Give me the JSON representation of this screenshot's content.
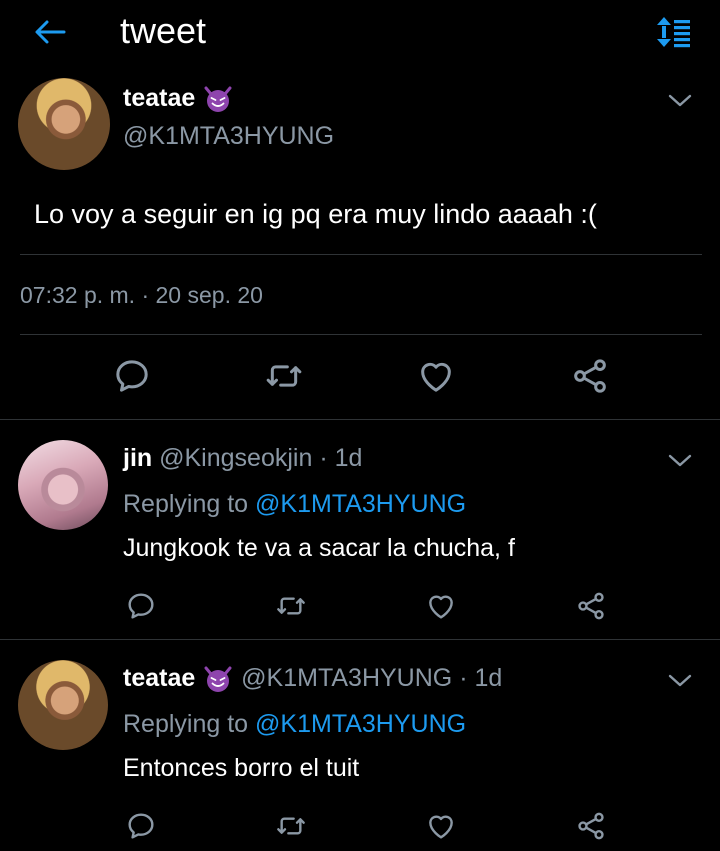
{
  "header": {
    "title": "tweet"
  },
  "icons": {
    "back": "arrow-left-icon",
    "sort": "sort-icon",
    "reply": "reply-icon",
    "retweet": "retweet-icon",
    "like": "heart-icon",
    "share": "share-icon",
    "more": "chevron-down-icon",
    "name_emoji": "smiling-devil-emoji"
  },
  "colors": {
    "accent": "#1d9bf0",
    "secondary_text": "#8b98a5",
    "background": "#000000",
    "emoji": "#8e44ad"
  },
  "main_tweet": {
    "name": "teatae",
    "handle": "@K1MTA3HYUNG",
    "text": "Lo voy a seguir en ig pq era muy lindo aaaah :(",
    "timestamp": "07:32 p. m. · 20 sep. 20"
  },
  "replies": [
    {
      "name": "jin",
      "handle": "@Kingseokjin",
      "age": "· 1d",
      "replying_label": "Replying to",
      "replying_handle": "@K1MTA3HYUNG",
      "text": "Jungkook te va a sacar la chucha, f"
    },
    {
      "name": "teatae",
      "handle": "@K1MTA3HYUNG",
      "age": "· 1d",
      "replying_label": "Replying to",
      "replying_handle": "@K1MTA3HYUNG",
      "text": "Entonces borro el tuit"
    }
  ]
}
